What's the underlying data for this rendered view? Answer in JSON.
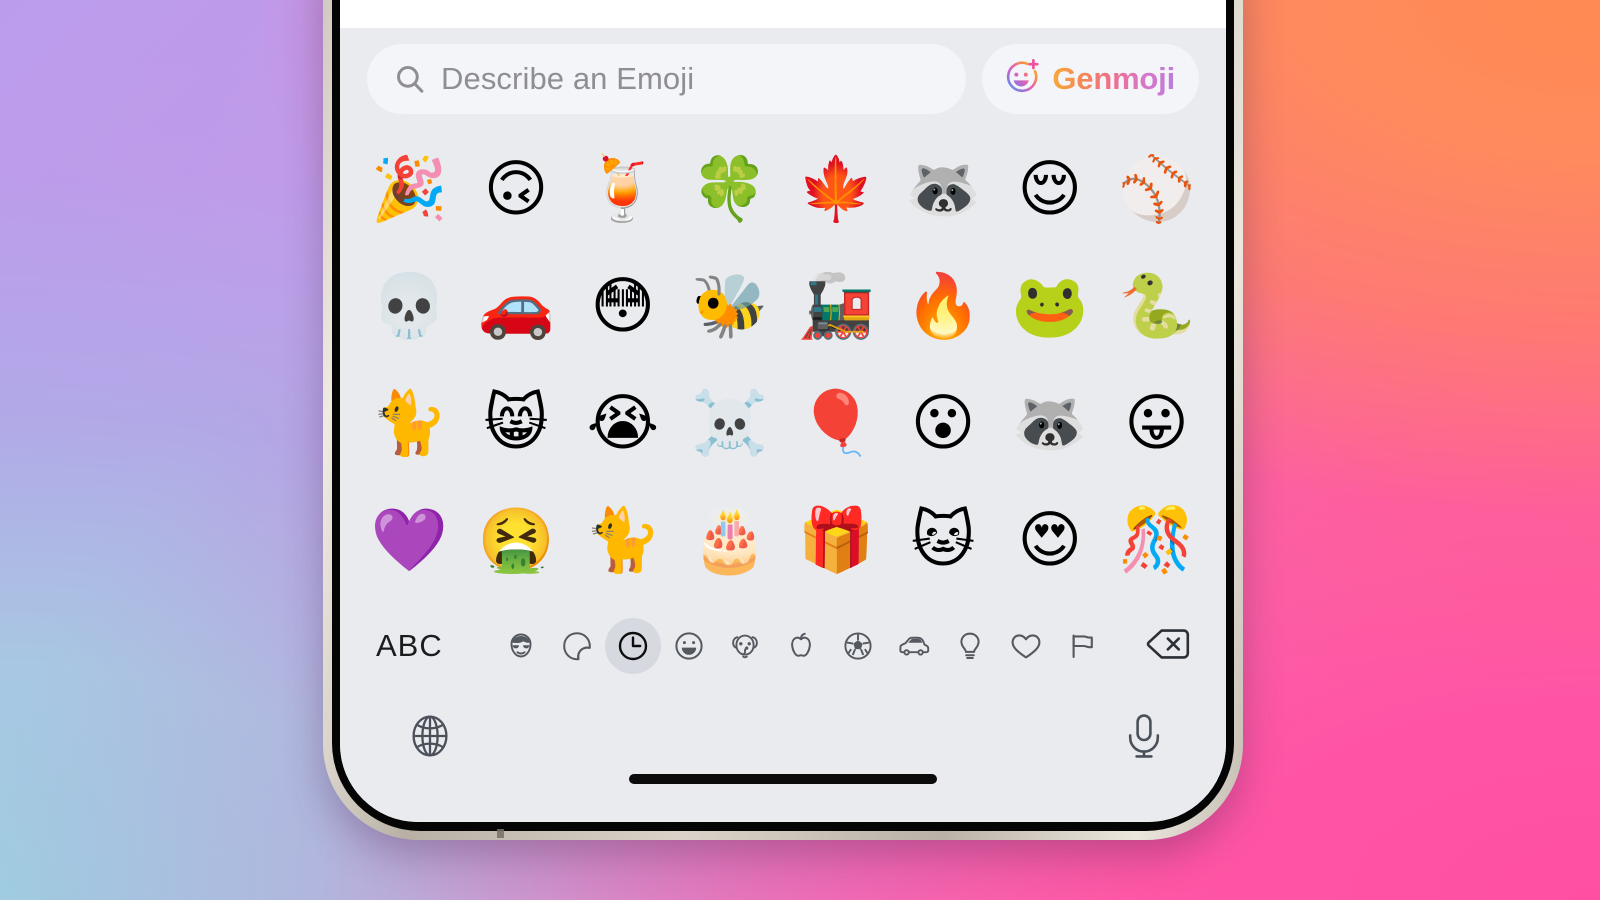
{
  "background": {
    "gradient_colors": [
      "#9ecde0",
      "#bb9cec",
      "#d48ad8",
      "#f279b4",
      "#ff4fa3",
      "#ff8a52"
    ]
  },
  "device": {
    "name": "iPhone",
    "frame_color": "#cdc6bc",
    "bezel_color": "#050505",
    "home_indicator_color": "#0b0b0c"
  },
  "keyboard": {
    "background_color": "#e9ebef",
    "search": {
      "icon": "search-icon",
      "placeholder": "Describe an Emoji",
      "value": "",
      "field_color": "#f4f5f8",
      "placeholder_color": "#8e8e93"
    },
    "genmoji_button": {
      "label": "Genmoji",
      "icon": "genmoji-smiley-plus-icon",
      "background_color": "#f4f5f8",
      "gradient_colors": [
        "#f6a93b",
        "#f58b53",
        "#ee6f8c",
        "#d977c8",
        "#b97ddd"
      ]
    },
    "emoji_grid": {
      "columns": 8,
      "rows": 4,
      "cells": [
        {
          "name": "party-popper",
          "glyph": "🎉"
        },
        {
          "name": "upside-down-face",
          "glyph": "🙃"
        },
        {
          "name": "tropical-drink-parrot",
          "glyph": "🍹"
        },
        {
          "name": "four-leaf-clover",
          "glyph": "🍀"
        },
        {
          "name": "maple-leaf",
          "glyph": "🍁"
        },
        {
          "name": "raccoon-reading-book",
          "glyph": "🦝"
        },
        {
          "name": "relieved-face",
          "glyph": "😌"
        },
        {
          "name": "baseball",
          "glyph": "⚾"
        },
        {
          "name": "skull",
          "glyph": "💀"
        },
        {
          "name": "crocodile-driving-car",
          "glyph": "🚗"
        },
        {
          "name": "flushed-face",
          "glyph": "😳"
        },
        {
          "name": "honeybee",
          "glyph": "🐝"
        },
        {
          "name": "goose-on-train",
          "glyph": "🚂"
        },
        {
          "name": "fire",
          "glyph": "🔥"
        },
        {
          "name": "frog",
          "glyph": "🐸"
        },
        {
          "name": "santa-snake",
          "glyph": "🐍"
        },
        {
          "name": "orange-cat-lying",
          "glyph": "🐈"
        },
        {
          "name": "grinning-cat-face",
          "glyph": "😸"
        },
        {
          "name": "loudly-crying-face",
          "glyph": "😭"
        },
        {
          "name": "silver-skull",
          "glyph": "☠️"
        },
        {
          "name": "balloon",
          "glyph": "🎈"
        },
        {
          "name": "hushed-face",
          "glyph": "😮"
        },
        {
          "name": "santa-raccoon-snow",
          "glyph": "🦝"
        },
        {
          "name": "face-with-tongue",
          "glyph": "😛"
        },
        {
          "name": "purple-heart",
          "glyph": "💜"
        },
        {
          "name": "vomiting-face",
          "glyph": "🤮"
        },
        {
          "name": "sleeping-orange-cat",
          "glyph": "🐈"
        },
        {
          "name": "birthday-cake",
          "glyph": "🎂"
        },
        {
          "name": "wrapped-gift",
          "glyph": "🎁"
        },
        {
          "name": "cat-in-blanket",
          "glyph": "🐱"
        },
        {
          "name": "smiling-face-with-heart-eyes",
          "glyph": "😍"
        },
        {
          "name": "confetti-ball",
          "glyph": "🎊"
        }
      ]
    },
    "category_bar": {
      "abc_label": "ABC",
      "selected_index": 2,
      "categories": [
        {
          "name": "memoji",
          "icon": "memoji-face-icon"
        },
        {
          "name": "stickers",
          "icon": "sticker-peel-icon"
        },
        {
          "name": "frequently-used",
          "icon": "clock-icon"
        },
        {
          "name": "smileys-and-people",
          "icon": "smiley-icon"
        },
        {
          "name": "animals-and-nature",
          "icon": "dog-icon"
        },
        {
          "name": "food-and-drink",
          "icon": "apple-icon"
        },
        {
          "name": "activity",
          "icon": "soccer-ball-icon"
        },
        {
          "name": "travel-and-places",
          "icon": "car-icon"
        },
        {
          "name": "objects",
          "icon": "lightbulb-icon"
        },
        {
          "name": "symbols",
          "icon": "heart-icon"
        },
        {
          "name": "flags",
          "icon": "flag-icon"
        }
      ],
      "delete_key": {
        "name": "delete",
        "icon": "backspace-icon"
      },
      "selected_highlight_color": "#d6d9df",
      "icon_color": "#54585f"
    },
    "utility_bar": {
      "globe": {
        "name": "next-keyboard",
        "icon": "globe-icon"
      },
      "dictation": {
        "name": "dictation",
        "icon": "microphone-icon"
      }
    }
  }
}
